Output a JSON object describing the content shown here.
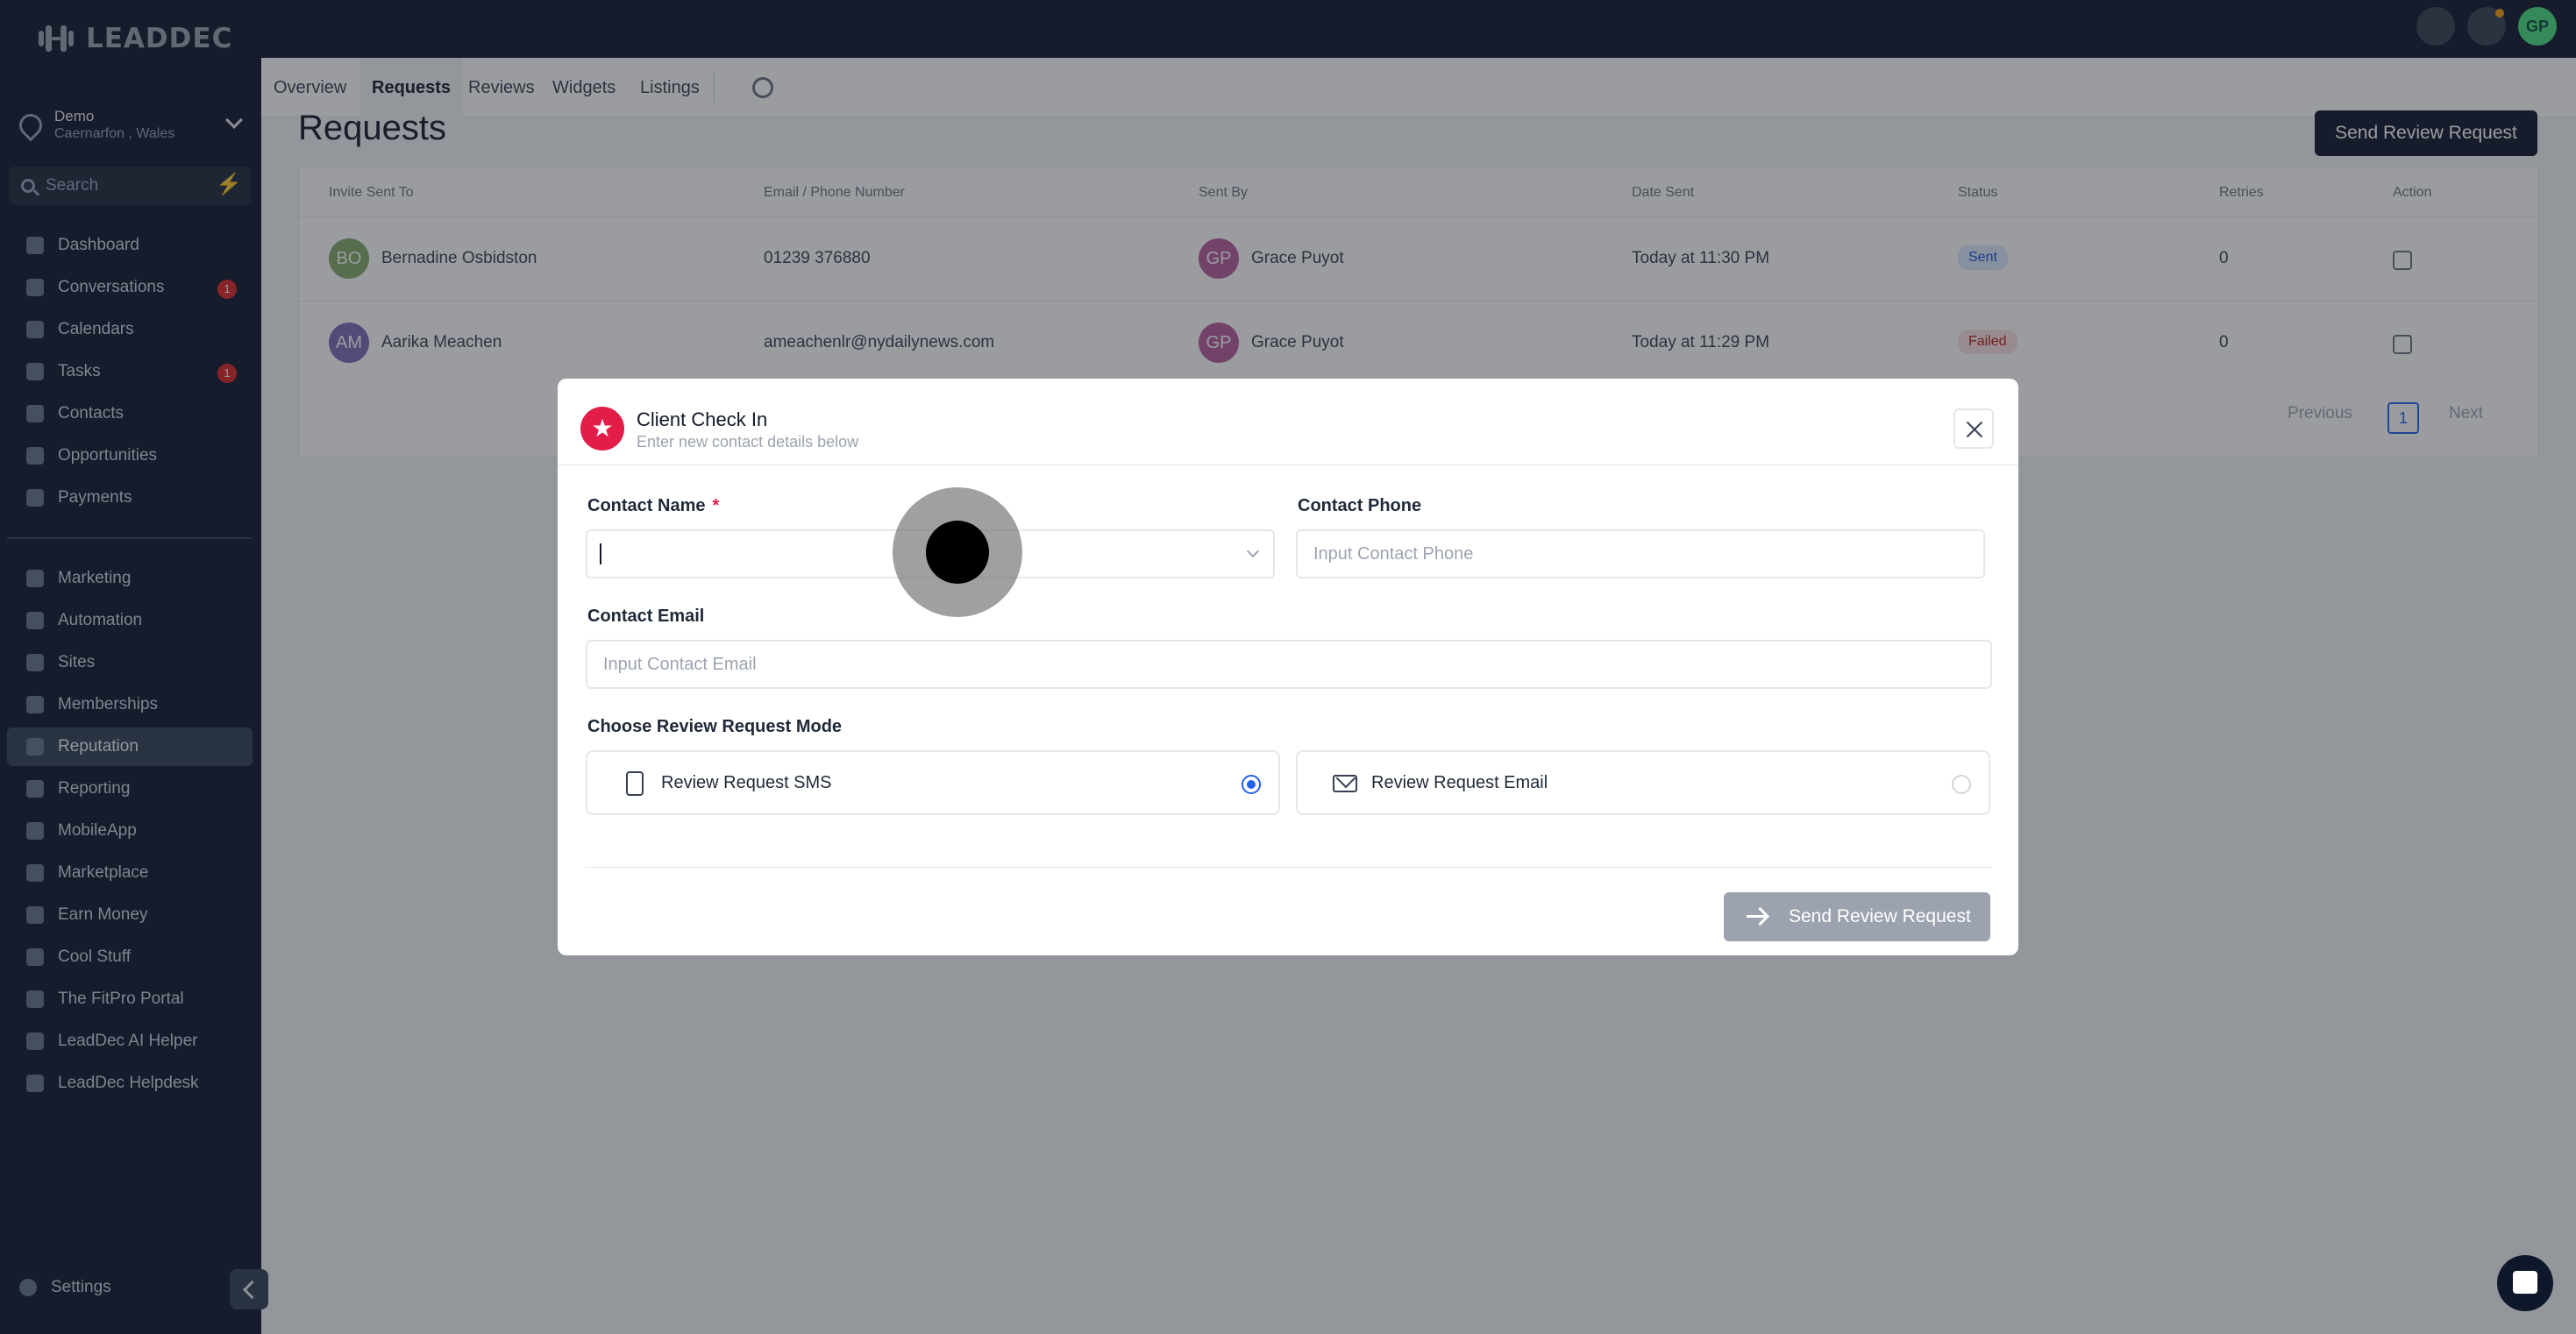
{
  "brand": {
    "logo_text": "LEADDEC"
  },
  "location": {
    "name": "Demo",
    "sub": "Caernarfon , Wales"
  },
  "search": {
    "placeholder": "Search"
  },
  "sidebar": {
    "items": [
      {
        "label": "Dashboard"
      },
      {
        "label": "Conversations",
        "badge": "1"
      },
      {
        "label": "Calendars"
      },
      {
        "label": "Tasks",
        "badge": "1"
      },
      {
        "label": "Contacts"
      },
      {
        "label": "Opportunities"
      },
      {
        "label": "Payments"
      },
      {
        "label": "Marketing"
      },
      {
        "label": "Automation"
      },
      {
        "label": "Sites"
      },
      {
        "label": "Memberships"
      },
      {
        "label": "Reputation",
        "active": true
      },
      {
        "label": "Reporting"
      },
      {
        "label": "MobileApp"
      },
      {
        "label": "Marketplace"
      },
      {
        "label": "Earn Money"
      },
      {
        "label": "Cool Stuff"
      },
      {
        "label": "The FitPro Portal"
      },
      {
        "label": "LeadDec AI Helper"
      },
      {
        "label": "LeadDec Helpdesk"
      }
    ],
    "settings_label": "Settings"
  },
  "topbar": {
    "avatar_initials": "GP"
  },
  "tabs": [
    {
      "label": "Overview"
    },
    {
      "label": "Requests",
      "active": true
    },
    {
      "label": "Reviews"
    },
    {
      "label": "Widgets"
    },
    {
      "label": "Listings"
    }
  ],
  "page": {
    "title": "Requests",
    "send_button": "Send Review Request"
  },
  "table": {
    "headers": [
      "Invite Sent To",
      "Email / Phone Number",
      "Sent By",
      "Date Sent",
      "Status",
      "Retries",
      "Action"
    ],
    "rows": [
      {
        "initials": "BO",
        "name": "Bernadine Osbidston",
        "contact": "01239 376880",
        "sender_initials": "GP",
        "sender": "Grace Puyot",
        "date": "Today at 11:30 PM",
        "status": "Sent",
        "retries": "0"
      },
      {
        "initials": "AM",
        "name": "Aarika Meachen",
        "contact": "ameachenlr@nydailynews.com",
        "sender_initials": "GP",
        "sender": "Grace Puyot",
        "date": "Today at 11:29 PM",
        "status": "Failed",
        "retries": "0"
      }
    ],
    "pagination": {
      "previous": "Previous",
      "page": "1",
      "next": "Next"
    }
  },
  "modal": {
    "title": "Client Check In",
    "subtitle": "Enter new contact details below",
    "contact_name_label": "Contact Name",
    "required_mark": "*",
    "contact_name_value": "",
    "contact_phone_label": "Contact Phone",
    "contact_phone_placeholder": "Input Contact Phone",
    "contact_email_label": "Contact Email",
    "contact_email_placeholder": "Input Contact Email",
    "mode_label": "Choose Review Request Mode",
    "mode_sms": "Review Request SMS",
    "mode_email": "Review Request Email",
    "selected_mode": "sms",
    "submit": "Send Review Request"
  },
  "colors": {
    "sidebar_bg": "#0f172a",
    "accent": "#2563eb",
    "modal_icon": "#e11d48",
    "status_sent": "#dbeafe",
    "status_failed": "#fee2e2"
  }
}
